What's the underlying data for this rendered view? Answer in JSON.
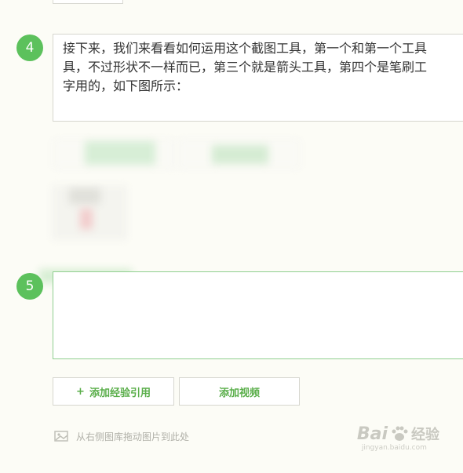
{
  "steps": [
    {
      "number": "4",
      "text_lines": [
        "接下来，我们来看看如何运用这个截图工具，第一个和第一个工具",
        "具，不过形状不一样而已，第三个就是箭头工具，第四个是笔刷工",
        "字用的，如下图所示："
      ]
    },
    {
      "number": "5",
      "text_lines": []
    }
  ],
  "actions": {
    "add_reference_label": "添加经验引用",
    "add_reference_icon": "+",
    "add_video_label": "添加视频"
  },
  "drag_hint": "从右侧图库拖动图片到此处",
  "watermark": {
    "brand": "Bai",
    "brand_cn": "经验",
    "url": "jingyan.baidu.com"
  },
  "colors": {
    "step_badge": "#5cc15c",
    "accent_text": "#5aae4a",
    "active_border": "#8fcf8f",
    "page_bg": "#fcfcf6"
  }
}
